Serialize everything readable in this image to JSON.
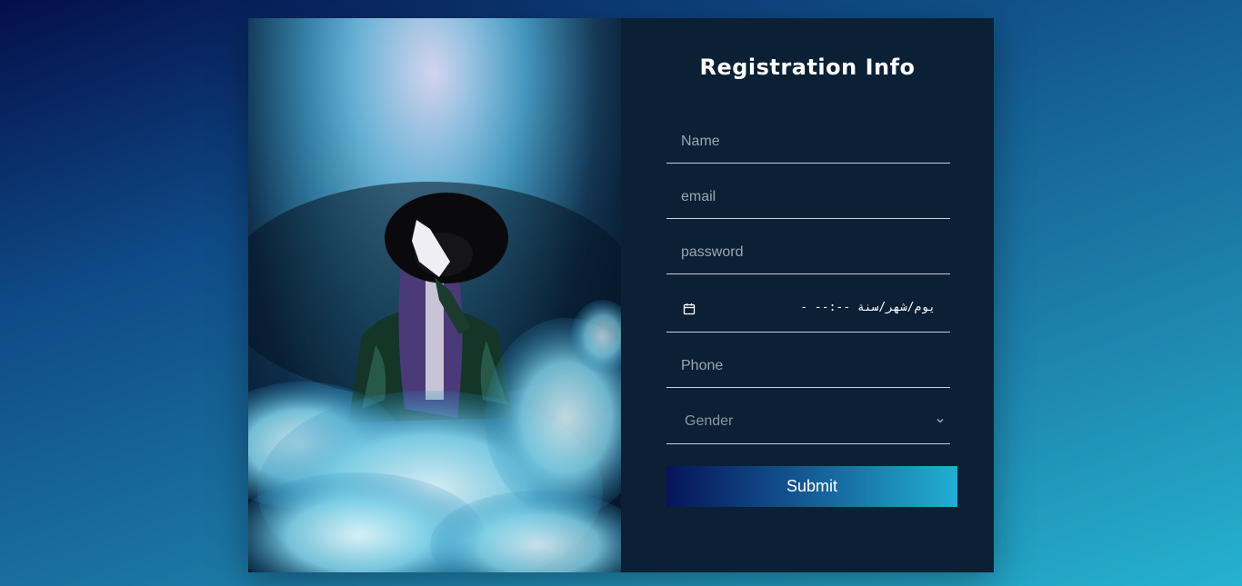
{
  "form": {
    "title": "Registration Info",
    "name_placeholder": "Name",
    "email_placeholder": "email",
    "password_placeholder": "password",
    "date_display": "يوم/شهر/سنة --:-- -",
    "phone_placeholder": "Phone",
    "gender_selected": "Gender",
    "submit_label": "Submit"
  },
  "colors": {
    "panel_background": "#0b2035",
    "button_gradient_start": "#06145a",
    "button_gradient_end": "#22b0d2"
  },
  "icons": {
    "date": "calendar-icon",
    "select": "chevron-down-icon"
  }
}
